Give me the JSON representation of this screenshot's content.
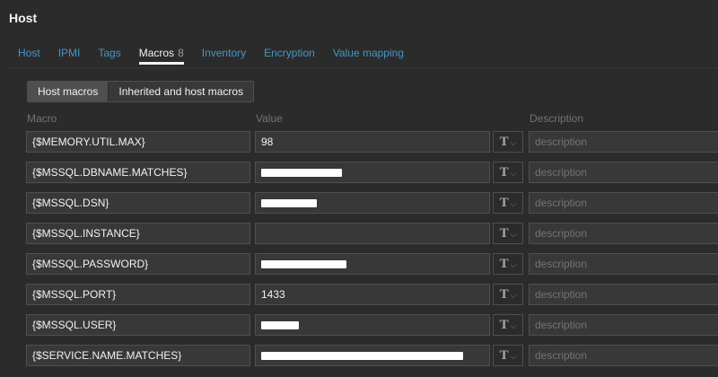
{
  "page": {
    "title": "Host"
  },
  "tabs": [
    {
      "label": "Host",
      "active": false
    },
    {
      "label": "IPMI",
      "active": false
    },
    {
      "label": "Tags",
      "active": false
    },
    {
      "label": "Macros",
      "count": "8",
      "active": true
    },
    {
      "label": "Inventory",
      "active": false
    },
    {
      "label": "Encryption",
      "active": false
    },
    {
      "label": "Value mapping",
      "active": false
    }
  ],
  "macro_view": {
    "host_macros": "Host macros",
    "inherited": "Inherited and host macros"
  },
  "columns": {
    "macro": "Macro",
    "value": "Value",
    "description": "Description"
  },
  "description_placeholder": "description",
  "type_glyph": "T",
  "type_icon": "text-type-icon",
  "macros": [
    {
      "macro": "{$MEMORY.UTIL.MAX}",
      "value": "98",
      "redacted": false
    },
    {
      "macro": "{$MSSQL.DBNAME.MATCHES}",
      "value": "",
      "redacted": true
    },
    {
      "macro": "{$MSSQL.DSN}",
      "value": "",
      "redacted": true
    },
    {
      "macro": "{$MSSQL.INSTANCE}",
      "value": "",
      "redacted": false
    },
    {
      "macro": "{$MSSQL.PASSWORD}",
      "value": "",
      "redacted": true
    },
    {
      "macro": "{$MSSQL.PORT}",
      "value": "1433",
      "redacted": false
    },
    {
      "macro": "{$MSSQL.USER}",
      "value": "",
      "redacted": true
    },
    {
      "macro": "{$SERVICE.NAME.MATCHES}",
      "value": "",
      "redacted": true
    }
  ],
  "colors": {
    "link": "#4796c4",
    "background": "#2b2b2b",
    "field": "#383838",
    "text": "#f2f2f2"
  }
}
